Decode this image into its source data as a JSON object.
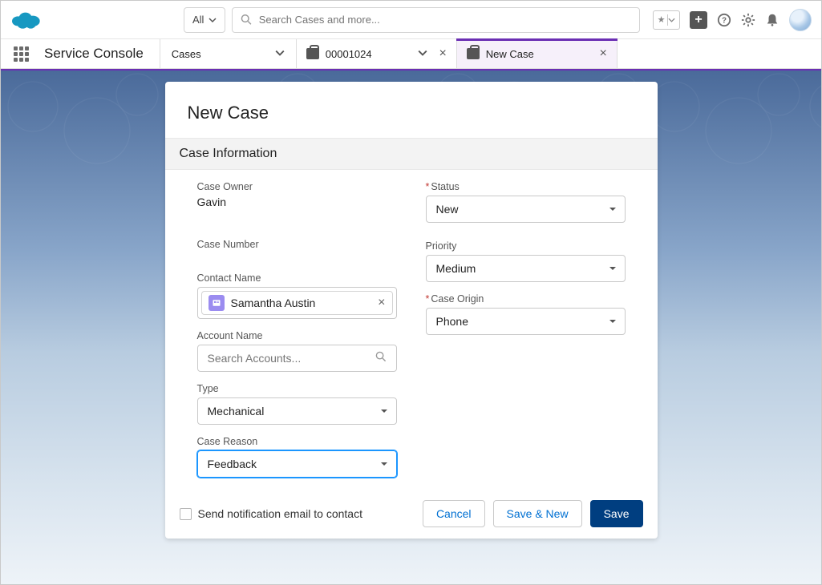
{
  "header": {
    "search_scope": "All",
    "search_placeholder": "Search Cases and more..."
  },
  "console": {
    "app_name": "Service Console",
    "object_tab": "Cases",
    "tabs": [
      {
        "label": "00001024",
        "active": false,
        "closeable": true
      },
      {
        "label": "New Case",
        "active": true,
        "closeable": true
      }
    ]
  },
  "modal": {
    "title": "New Case",
    "section": "Case Information",
    "fields": {
      "case_owner_label": "Case Owner",
      "case_owner_value": "Gavin",
      "case_number_label": "Case Number",
      "case_number_value": "",
      "contact_name_label": "Contact Name",
      "contact_name_value": "Samantha Austin",
      "account_name_label": "Account Name",
      "account_name_placeholder": "Search Accounts...",
      "type_label": "Type",
      "type_value": "Mechanical",
      "case_reason_label": "Case Reason",
      "case_reason_value": "Feedback",
      "status_label": "Status",
      "status_value": "New",
      "priority_label": "Priority",
      "priority_value": "Medium",
      "case_origin_label": "Case Origin",
      "case_origin_value": "Phone"
    },
    "footer": {
      "checkbox_label": "Send notification email to contact",
      "cancel": "Cancel",
      "save_new": "Save & New",
      "save": "Save"
    }
  }
}
